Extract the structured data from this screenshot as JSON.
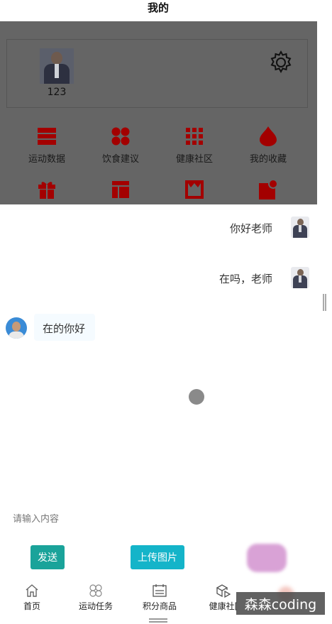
{
  "header": {
    "title": "我的"
  },
  "profile": {
    "username": "123"
  },
  "menu": {
    "row1": [
      {
        "label": "运动数据",
        "icon": "sport-data-icon"
      },
      {
        "label": "饮食建议",
        "icon": "diet-advice-icon"
      },
      {
        "label": "健康社区",
        "icon": "health-community-icon"
      },
      {
        "label": "我的收藏",
        "icon": "favorites-icon"
      }
    ],
    "row2": [
      {
        "icon": "gift-icon"
      },
      {
        "icon": "layout-icon"
      },
      {
        "icon": "shop-icon"
      },
      {
        "icon": "notification-icon"
      }
    ]
  },
  "chat": {
    "messages": [
      {
        "side": "right",
        "text": "你好老师"
      },
      {
        "side": "right",
        "text": "在吗，老师"
      },
      {
        "side": "left",
        "text": "在的你好"
      }
    ],
    "input_placeholder": "请输入内容",
    "send_label": "发送",
    "upload_label": "上传图片"
  },
  "tabbar": {
    "items": [
      {
        "label": "首页",
        "icon": "home-icon"
      },
      {
        "label": "运动任务",
        "icon": "clover-icon"
      },
      {
        "label": "积分商品",
        "icon": "calendar-icon"
      },
      {
        "label": "健康社[",
        "icon": "cube-play-icon"
      }
    ]
  },
  "watermark": "森森coding",
  "colors": {
    "accent_red": "#a30000",
    "send_button": "#1aa39a",
    "upload_button": "#14b4c9",
    "overlay": "#656565"
  }
}
